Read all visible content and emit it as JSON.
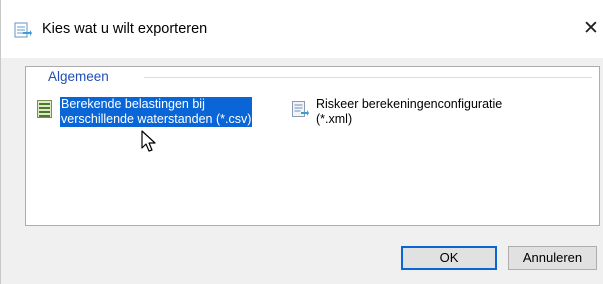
{
  "window": {
    "title": "Kies wat u wilt exporteren",
    "close_glyph": "✕",
    "icon": "export-icon"
  },
  "group": {
    "legend": "Algemeen",
    "items": [
      {
        "label": "Berekende belastingen bij\nverschillende waterstanden (*.csv)",
        "icon": "csv-export-icon",
        "selected": true
      },
      {
        "label": "Riskeer berekeningenconfiguratie\n(*.xml)",
        "icon": "xml-export-icon",
        "selected": false
      }
    ]
  },
  "buttons": {
    "ok": "OK",
    "cancel": "Annuleren"
  },
  "colors": {
    "selection": "#0a66d6",
    "legend": "#1f4fb3",
    "dialog_background": "#f0f0f0"
  }
}
